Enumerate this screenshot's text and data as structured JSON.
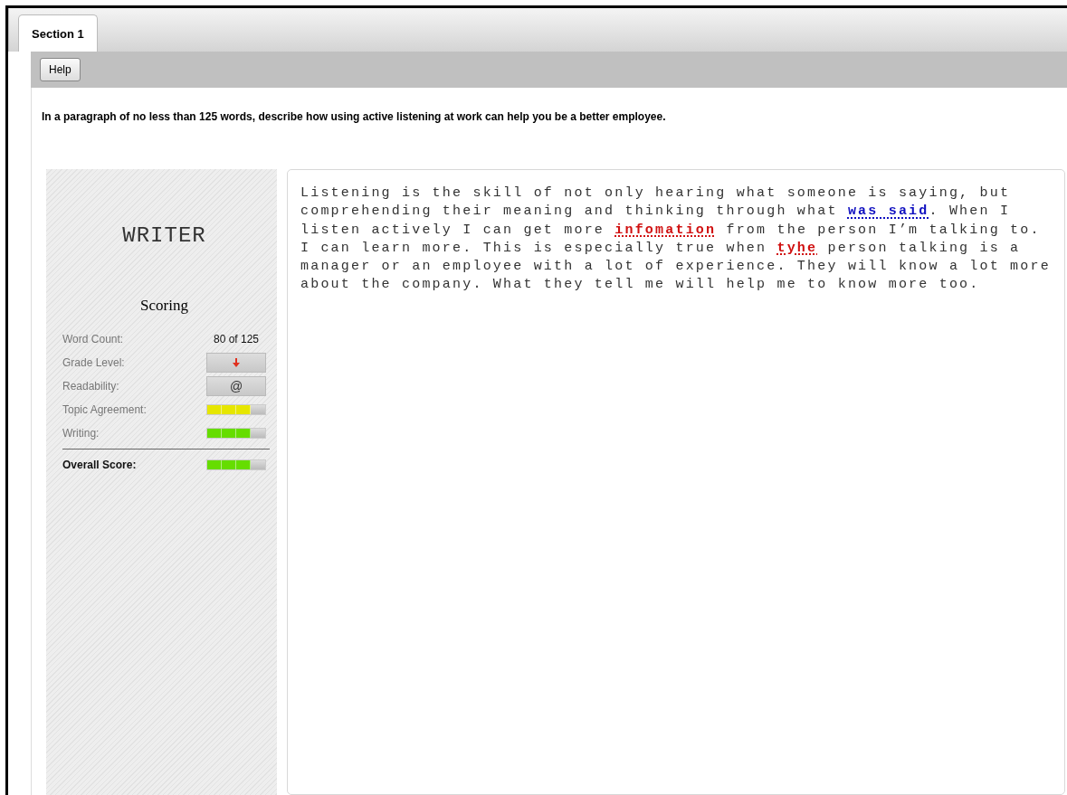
{
  "tabs": [
    {
      "label": "Section 1",
      "selected": true
    }
  ],
  "toolbar": {
    "buttons": [
      "Help"
    ]
  },
  "prompt": "In a paragraph of no less than 125 words, describe how using active listening at work can help you be a better employee.",
  "sidebar": {
    "title": "WRITER",
    "heading": "Scoring",
    "rows": [
      {
        "kind": "text",
        "label": "Word Count:",
        "value": "80 of 125"
      },
      {
        "kind": "arrow",
        "label": "Grade Level:"
      },
      {
        "kind": "symbol",
        "label": "Readability:",
        "value": "@"
      },
      {
        "kind": "meter",
        "label": "Topic Agreement:",
        "level": 0.75,
        "color": "#e6e600"
      },
      {
        "kind": "meter",
        "label": "Writing:",
        "level": 0.75,
        "color": "#66dd00"
      }
    ],
    "overall": {
      "label": "Overall Score:",
      "level": 0.75,
      "color": "#66dd00"
    }
  },
  "essay": [
    {
      "kind": "plain",
      "text": "Listening is the skill of not only hearing what someone is saying, but comprehending their meaning and thinking through what "
    },
    {
      "kind": "grammar",
      "text": "was said"
    },
    {
      "kind": "plain",
      "text": ". When I listen actively I can get more "
    },
    {
      "kind": "spelling",
      "text": "infomation"
    },
    {
      "kind": "plain",
      "text": " from the person I’m talking to. I can learn more. This is especially true when "
    },
    {
      "kind": "spelling",
      "text": "tyhe"
    },
    {
      "kind": "plain",
      "text": " person talking is a manager or an employee with a lot of experience. They will know a lot more about the company. What they tell me will help me to know more too."
    }
  ]
}
